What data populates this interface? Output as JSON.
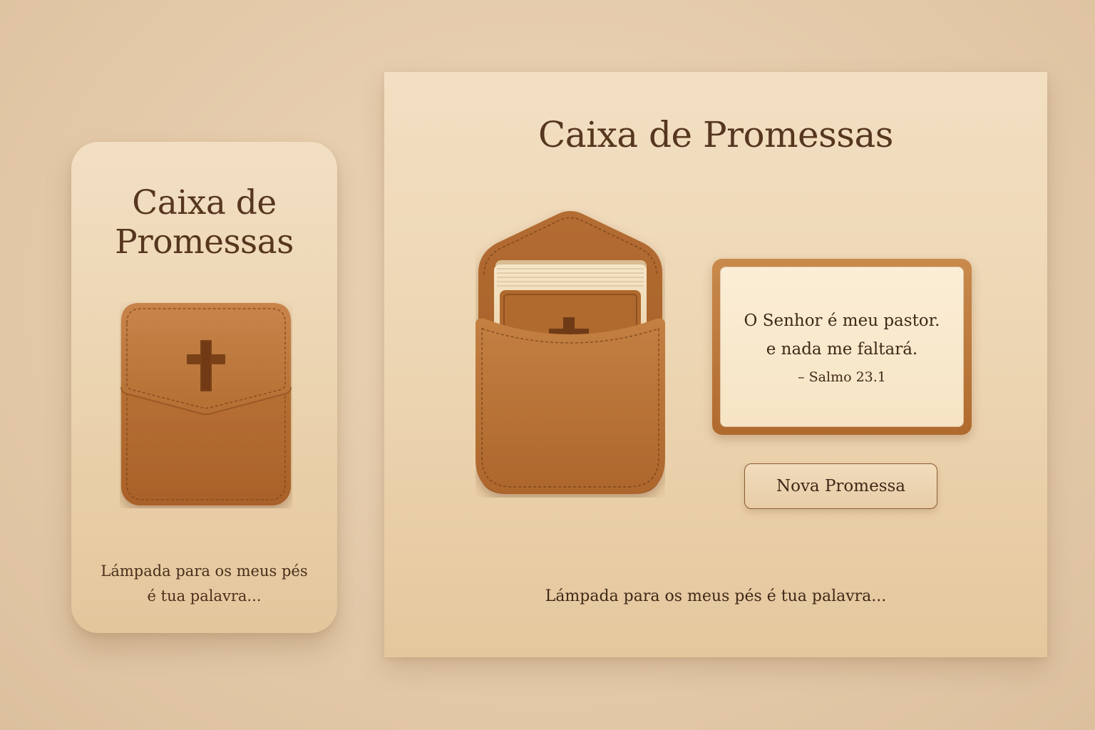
{
  "mobile": {
    "title_line1": "Caixa de",
    "title_line2": "Promessas",
    "tagline_line1": "Lámpada para os meus pés",
    "tagline_line2": "é tua palavra..."
  },
  "desktop": {
    "title": "Caixa de Promessas",
    "verse": {
      "line1": "O Senhor é meu pastor.",
      "line2": "e nada me faltará.",
      "reference": "– Salmo 23.1"
    },
    "new_button_label": "Nova Promessa",
    "tagline": "Lámpada para os meus pés é tua palavra..."
  },
  "icons": {
    "pouch_closed": "leather-pouch-with-cross",
    "pouch_open": "open-leather-pouch-with-cards",
    "cross": "cross-icon"
  },
  "colors": {
    "background": "#e2c7a6",
    "panel": "#efd9b8",
    "title_text": "#56361f",
    "leather": "#b66f33",
    "leather_dark": "#8f4f1f",
    "card_paper": "#f8e8cc"
  }
}
